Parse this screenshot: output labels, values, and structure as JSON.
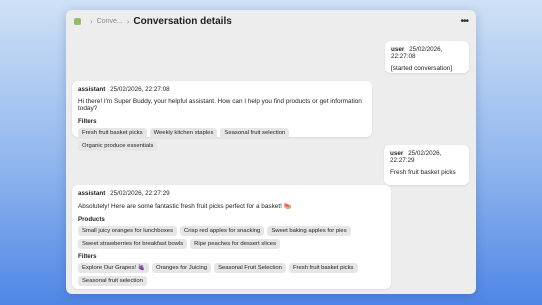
{
  "window": {
    "breadcrumb": "Conve...",
    "title": "Conversation details",
    "menu_icon": "ellipsis-icon"
  },
  "messages": [
    {
      "role": "user",
      "timestamp": "25/02/2026, 22:27:08",
      "text": "[started conversation]"
    },
    {
      "role": "assistant",
      "timestamp": "25/02/2026, 22:27:08",
      "text": "Hi there! I'm Super Buddy, your helpful assistant. How can I help you find products or get information today?",
      "filters_label": "Filters",
      "filters": [
        "Fresh fruit basket picks",
        "Weekly kitchen staples",
        "Seasonal fruit selection",
        "Organic produce essentials"
      ]
    },
    {
      "role": "user",
      "timestamp": "25/02/2026, 22:27:29",
      "text": "Fresh fruit basket picks"
    },
    {
      "role": "assistant",
      "timestamp": "25/02/2026, 22:27:29",
      "text": "Absolutely! Here are some fantastic fresh fruit picks perfect for a basket! 🍉",
      "products_label": "Products",
      "products": [
        "Small juicy oranges for lunchboxes",
        "Crisp red apples for snacking",
        "Sweet baking apples for pies",
        "Sweet strawberries for breakfast bowls",
        "Ripe peaches for dessert slices"
      ],
      "filters_label": "Filters",
      "filters": [
        "Explore Our Grapes! 🍇",
        "Oranges for Juicing",
        "Seasonal Fruit Selection",
        "Fresh fruit basket picks",
        "Seasonal fruit selection"
      ]
    }
  ]
}
